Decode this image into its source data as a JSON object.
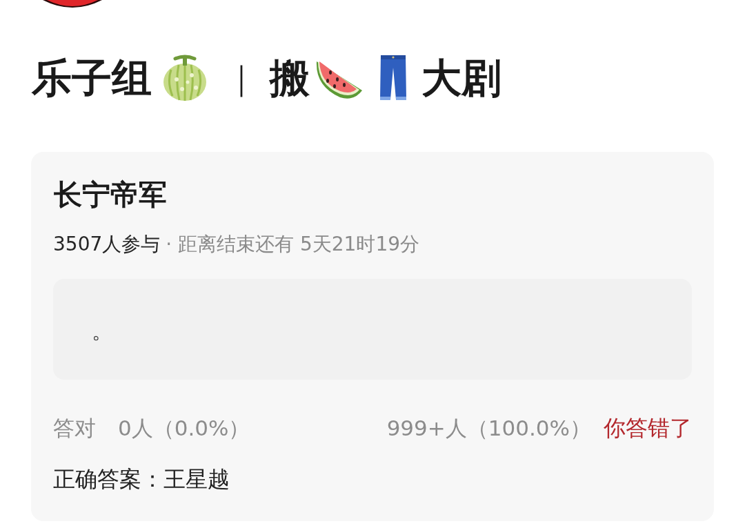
{
  "post_title": {
    "group": "乐子组",
    "separator": "｜",
    "action": "搬",
    "suffix": "大剧"
  },
  "quiz": {
    "title": "长宁帝军",
    "participants": "3507人参与",
    "deadline": "· 距离结束还有 5天21时19分",
    "answer_text": "。",
    "correct_label": "答对",
    "correct_count": "0人（0.0%）",
    "wrong_count": "999+人（100.0%）",
    "result": "你答错了",
    "correct_answer": "正确答案：王星越"
  }
}
